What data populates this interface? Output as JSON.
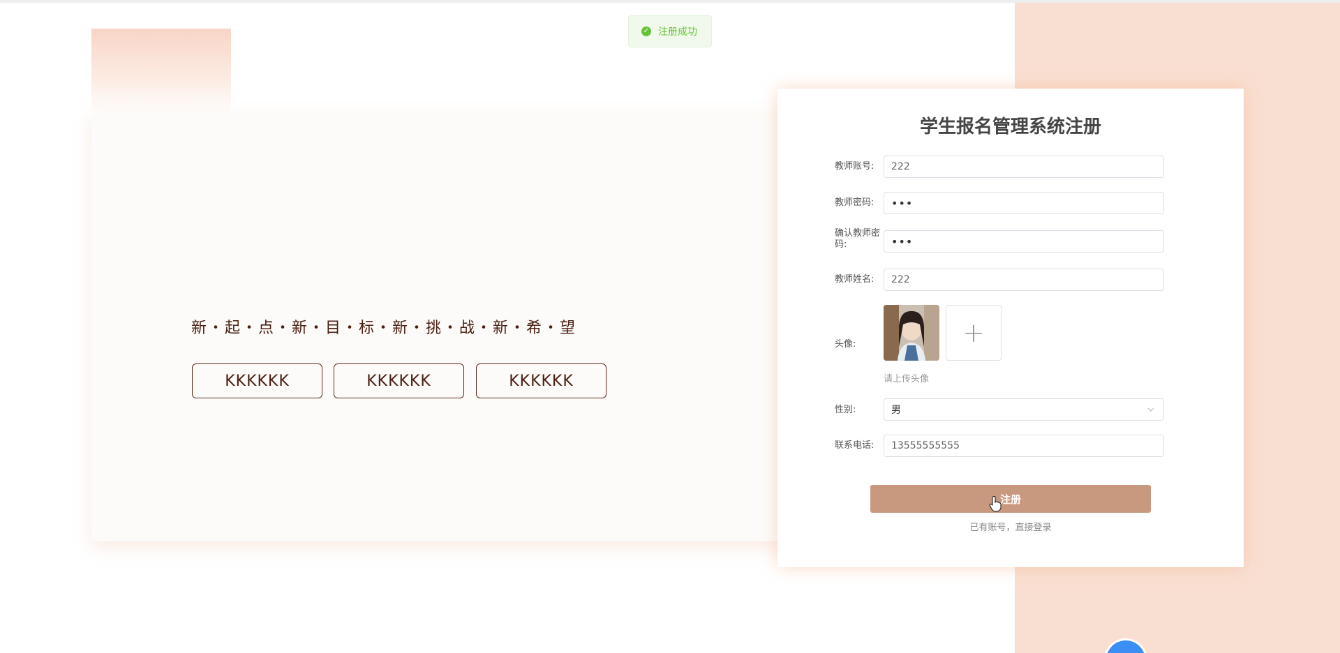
{
  "toast": {
    "message": "注册成功",
    "color": "#67c23a"
  },
  "hero": {
    "slogan": "新・起・点・新・目・标・新・挑・战・新・希・望",
    "buttons": [
      "KKKKKK",
      "KKKKKK",
      "KKKKKK"
    ]
  },
  "form": {
    "title": "学生报名管理系统注册",
    "account_label": "教师账号:",
    "account_value": "222",
    "password_label": "教师密码:",
    "password_value": "•••",
    "confirm_label": "确认教师密码:",
    "confirm_value": "•••",
    "name_label": "教师姓名:",
    "name_value": "222",
    "avatar_label": "头像:",
    "upload_hint": "请上传头像",
    "upload_plus": "+",
    "gender_label": "性别:",
    "gender_value": "男",
    "phone_label": "联系电话:",
    "phone_value": "13555555555",
    "submit_label": "注册",
    "login_link": "已有账号，直接登录"
  },
  "colors": {
    "accent": "#c9997f",
    "right_background": "#f9dfd1",
    "slogan_text": "#4a1f12"
  },
  "icons": {
    "toast": "check-circle-icon",
    "upload": "plus-icon",
    "select": "chevron-down-icon",
    "cursor": "hand-pointer-icon"
  }
}
